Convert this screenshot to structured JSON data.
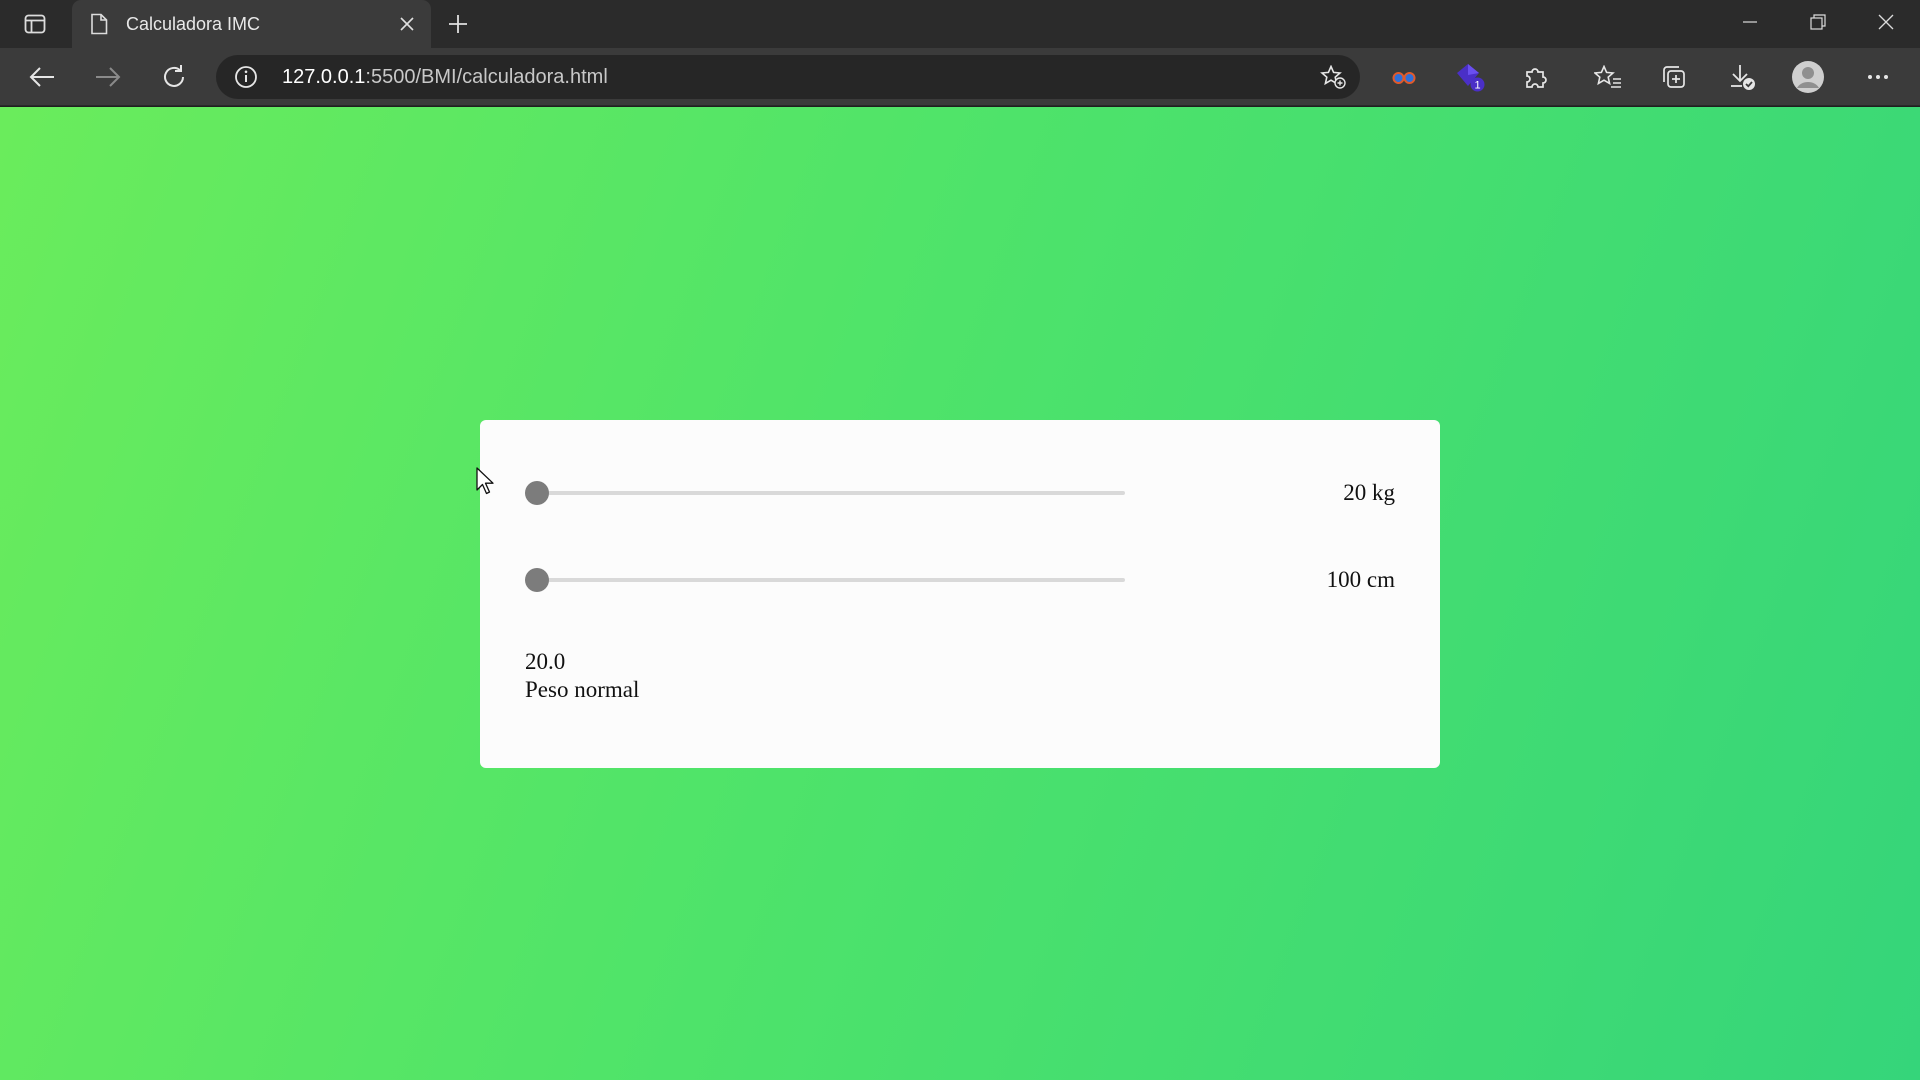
{
  "browser": {
    "tab": {
      "title": "Calculadora IMC",
      "close_icon": "close-icon"
    },
    "url": {
      "host": "127.0.0.1",
      "path": ":5500/BMI/calculadora.html"
    },
    "extensions": [
      {
        "name": "glasses-extension-icon"
      },
      {
        "name": "purple-extension-icon",
        "badge": "1"
      }
    ]
  },
  "calculator": {
    "weight": {
      "value": 20,
      "min": 20,
      "max": 200,
      "label": "20 kg"
    },
    "height": {
      "value": 100,
      "min": 100,
      "max": 220,
      "label": "100 cm"
    },
    "result": {
      "bmi": "20.0",
      "category": "Peso normal"
    }
  },
  "colors": {
    "gradient_start": "#6aec5c",
    "gradient_end": "#35d57a",
    "card": "#fcfcfc",
    "slider_thumb": "#7c7c7c"
  }
}
